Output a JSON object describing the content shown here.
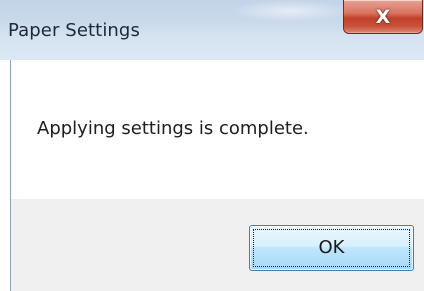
{
  "window": {
    "title": "Paper Settings",
    "close_glyph": "X",
    "close_icon": "close-icon"
  },
  "dialog": {
    "message": "Applying settings is complete.",
    "ok_label": "OK"
  },
  "colors": {
    "close_button": "#c7503a",
    "titlebar": "#c9d9ec",
    "ok_button_border": "#3c7fb1"
  }
}
